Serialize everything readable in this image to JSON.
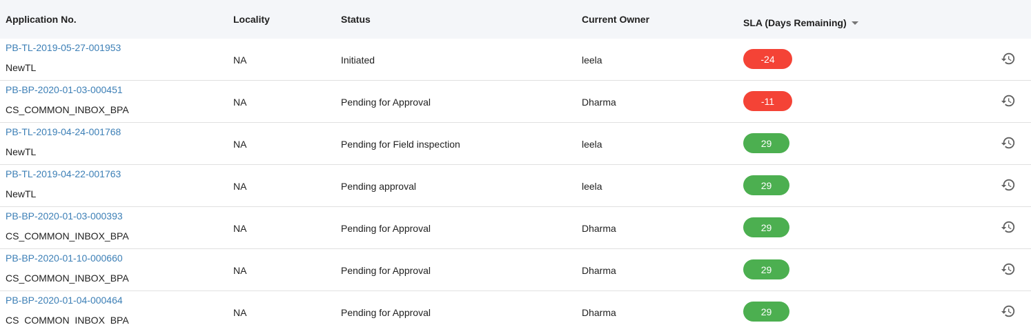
{
  "header": {
    "application_no": "Application No.",
    "locality": "Locality",
    "status": "Status",
    "current_owner": "Current Owner",
    "sla": "SLA (Days Remaining)"
  },
  "colors": {
    "sla_overdue": "#f44336",
    "sla_ok": "#4caf50",
    "link": "#3c7fb6",
    "history_icon": "#616161"
  },
  "rows": [
    {
      "app_no": "PB-TL-2019-05-27-001953",
      "type": "NewTL",
      "locality": "NA",
      "status": "Initiated",
      "owner": "leela",
      "sla": "-24"
    },
    {
      "app_no": "PB-BP-2020-01-03-000451",
      "type": "CS_COMMON_INBOX_BPA",
      "locality": "NA",
      "status": "Pending for Approval",
      "owner": "Dharma",
      "sla": "-11"
    },
    {
      "app_no": "PB-TL-2019-04-24-001768",
      "type": "NewTL",
      "locality": "NA",
      "status": "Pending for Field inspection",
      "owner": "leela",
      "sla": "29"
    },
    {
      "app_no": "PB-TL-2019-04-22-001763",
      "type": "NewTL",
      "locality": "NA",
      "status": "Pending approval",
      "owner": "leela",
      "sla": "29"
    },
    {
      "app_no": "PB-BP-2020-01-03-000393",
      "type": "CS_COMMON_INBOX_BPA",
      "locality": "NA",
      "status": "Pending for Approval",
      "owner": "Dharma",
      "sla": "29"
    },
    {
      "app_no": "PB-BP-2020-01-10-000660",
      "type": "CS_COMMON_INBOX_BPA",
      "locality": "NA",
      "status": "Pending for Approval",
      "owner": "Dharma",
      "sla": "29"
    },
    {
      "app_no": "PB-BP-2020-01-04-000464",
      "type": "CS_COMMON_INBOX_BPA",
      "locality": "NA",
      "status": "Pending for Approval",
      "owner": "Dharma",
      "sla": "29"
    }
  ]
}
